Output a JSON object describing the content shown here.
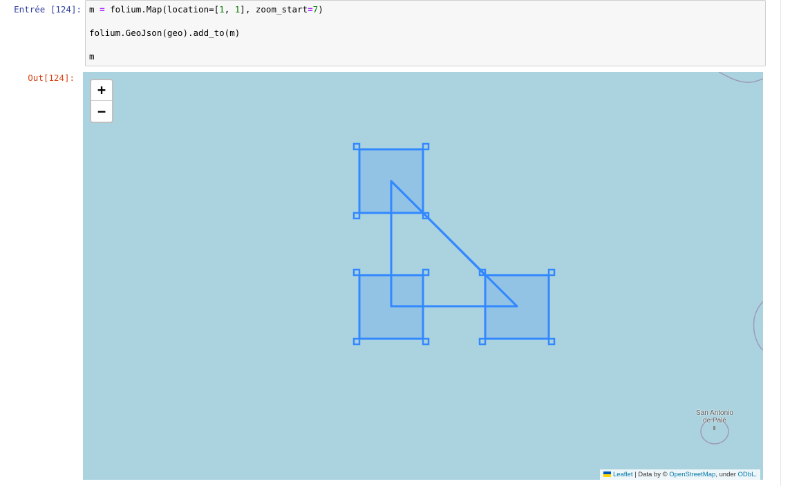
{
  "input_cell": {
    "prompt": "Entrée [124]:",
    "code": {
      "line1": {
        "a": "m ",
        "op": "=",
        "b": " folium.Map(location=[",
        "n1": "1",
        "c": ", ",
        "n2": "1",
        "d": "], zoom_start",
        "op2": "=",
        "n3": "7",
        "e": ")"
      },
      "line2": "folium.GeoJson(geo).add_to(m)",
      "line3": "m"
    }
  },
  "output_cell": {
    "prompt": "Out[124]:"
  },
  "map": {
    "zoom_in_label": "+",
    "zoom_out_label": "−",
    "place_label_line1": "San Antonio",
    "place_label_line2": "de Palé",
    "attribution": {
      "leaflet": "Leaflet",
      "sep": " | Data by © ",
      "osm": "OpenStreetMap",
      "under": ", under ",
      "odbl": "ODbL",
      "end": "."
    },
    "colors": {
      "water": "#aad3df",
      "geojson_stroke": "#3388ff",
      "boundary": "#9e9ab8"
    },
    "icons": {
      "leaflet_flag": "ukraine-flag-icon"
    }
  }
}
